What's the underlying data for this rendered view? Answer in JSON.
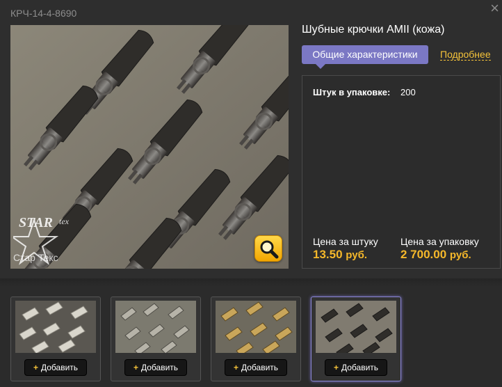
{
  "product": {
    "sku": "КРЧ-14-4-8690",
    "title": "Шубные крючки AMII (кожа)"
  },
  "tabs": {
    "active_label": "Общие характеристики",
    "more_label": "Подробнее"
  },
  "specs": {
    "pack_label": "Штук в упаковке:",
    "pack_value": "200"
  },
  "prices": {
    "unit_label": "Цена за штуку",
    "unit_value": "13.50",
    "pack_label": "Цена за упаковку",
    "pack_value": "2 700.00",
    "currency": "руб."
  },
  "watermark": {
    "logo": "STARtex",
    "text": "Стар Текс"
  },
  "thumbnails": [
    {
      "add_label": "Добавить",
      "tone": "#c9c6bd",
      "selected": false
    },
    {
      "add_label": "Добавить",
      "tone": "#8f8c7c",
      "selected": false
    },
    {
      "add_label": "Добавить",
      "tone": "#a98a4a",
      "selected": false
    },
    {
      "add_label": "Добавить",
      "tone": "#5a5449",
      "selected": true
    }
  ],
  "icons": {
    "close": "close-icon",
    "zoom": "magnifier-icon",
    "plus": "plus-icon"
  },
  "colors": {
    "accent_tab": "#7b78c4",
    "price": "#f5b82a",
    "link": "#f5c33a"
  }
}
